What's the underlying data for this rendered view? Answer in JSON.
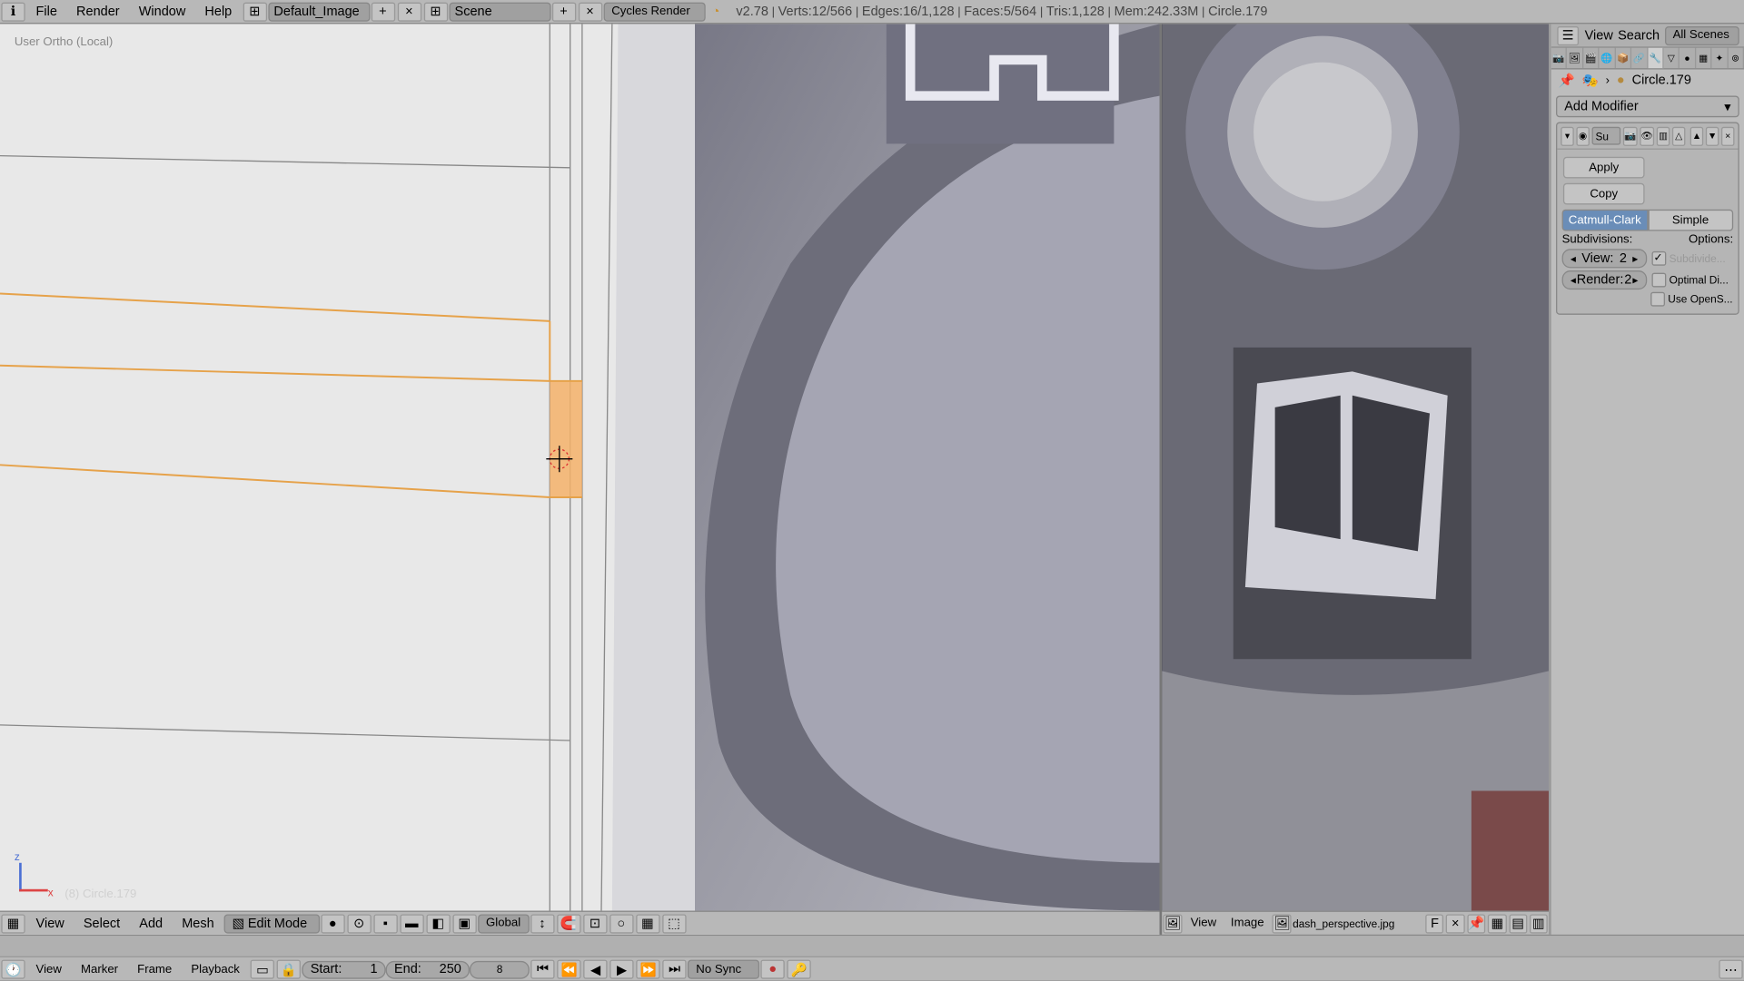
{
  "header": {
    "menus": [
      "File",
      "Render",
      "Window",
      "Help"
    ],
    "screen_layout": "Default_Image",
    "scene": "Scene",
    "render_engine": "Cycles Render",
    "version": "v2.78",
    "stats": {
      "verts": "Verts:12/566",
      "edges": "Edges:16/1,128",
      "faces": "Faces:5/564",
      "tris": "Tris:1,128",
      "mem": "Mem:242.33M",
      "obj": "Circle.179"
    }
  },
  "view3d": {
    "overlay": "User Ortho (Local)",
    "object": "(8) Circle.179",
    "menus": [
      "View",
      "Select",
      "Add",
      "Mesh"
    ],
    "mode": "Edit Mode",
    "orientation": "Global"
  },
  "imgedit": {
    "menus": [
      "View",
      "Image"
    ],
    "filename": "dash_perspective.jpg",
    "channel": "F"
  },
  "properties": {
    "search_placeholder": "",
    "view_label": "View",
    "search_label": "Search",
    "scenes_label": "All Scenes",
    "breadcrumb_obj": "Circle.179",
    "add_modifier": "Add Modifier",
    "modifier": {
      "type": "Su",
      "apply": "Apply",
      "copy": "Copy",
      "algo1": "Catmull-Clark",
      "algo2": "Simple",
      "subdivisions_lbl": "Subdivisions:",
      "options_lbl": "Options:",
      "view_lbl": "View:",
      "view_val": "2",
      "render_lbl": "Render:",
      "render_val": "2",
      "opt1": "Subdivide...",
      "opt2": "Optimal Di...",
      "opt3": "Use OpenS..."
    }
  },
  "timeline": {
    "menus": [
      "View",
      "Marker",
      "Frame",
      "Playback"
    ],
    "start_lbl": "Start:",
    "start_val": "1",
    "end_lbl": "End:",
    "end_val": "250",
    "current": "8",
    "sync": "No Sync"
  },
  "chart_data": null
}
